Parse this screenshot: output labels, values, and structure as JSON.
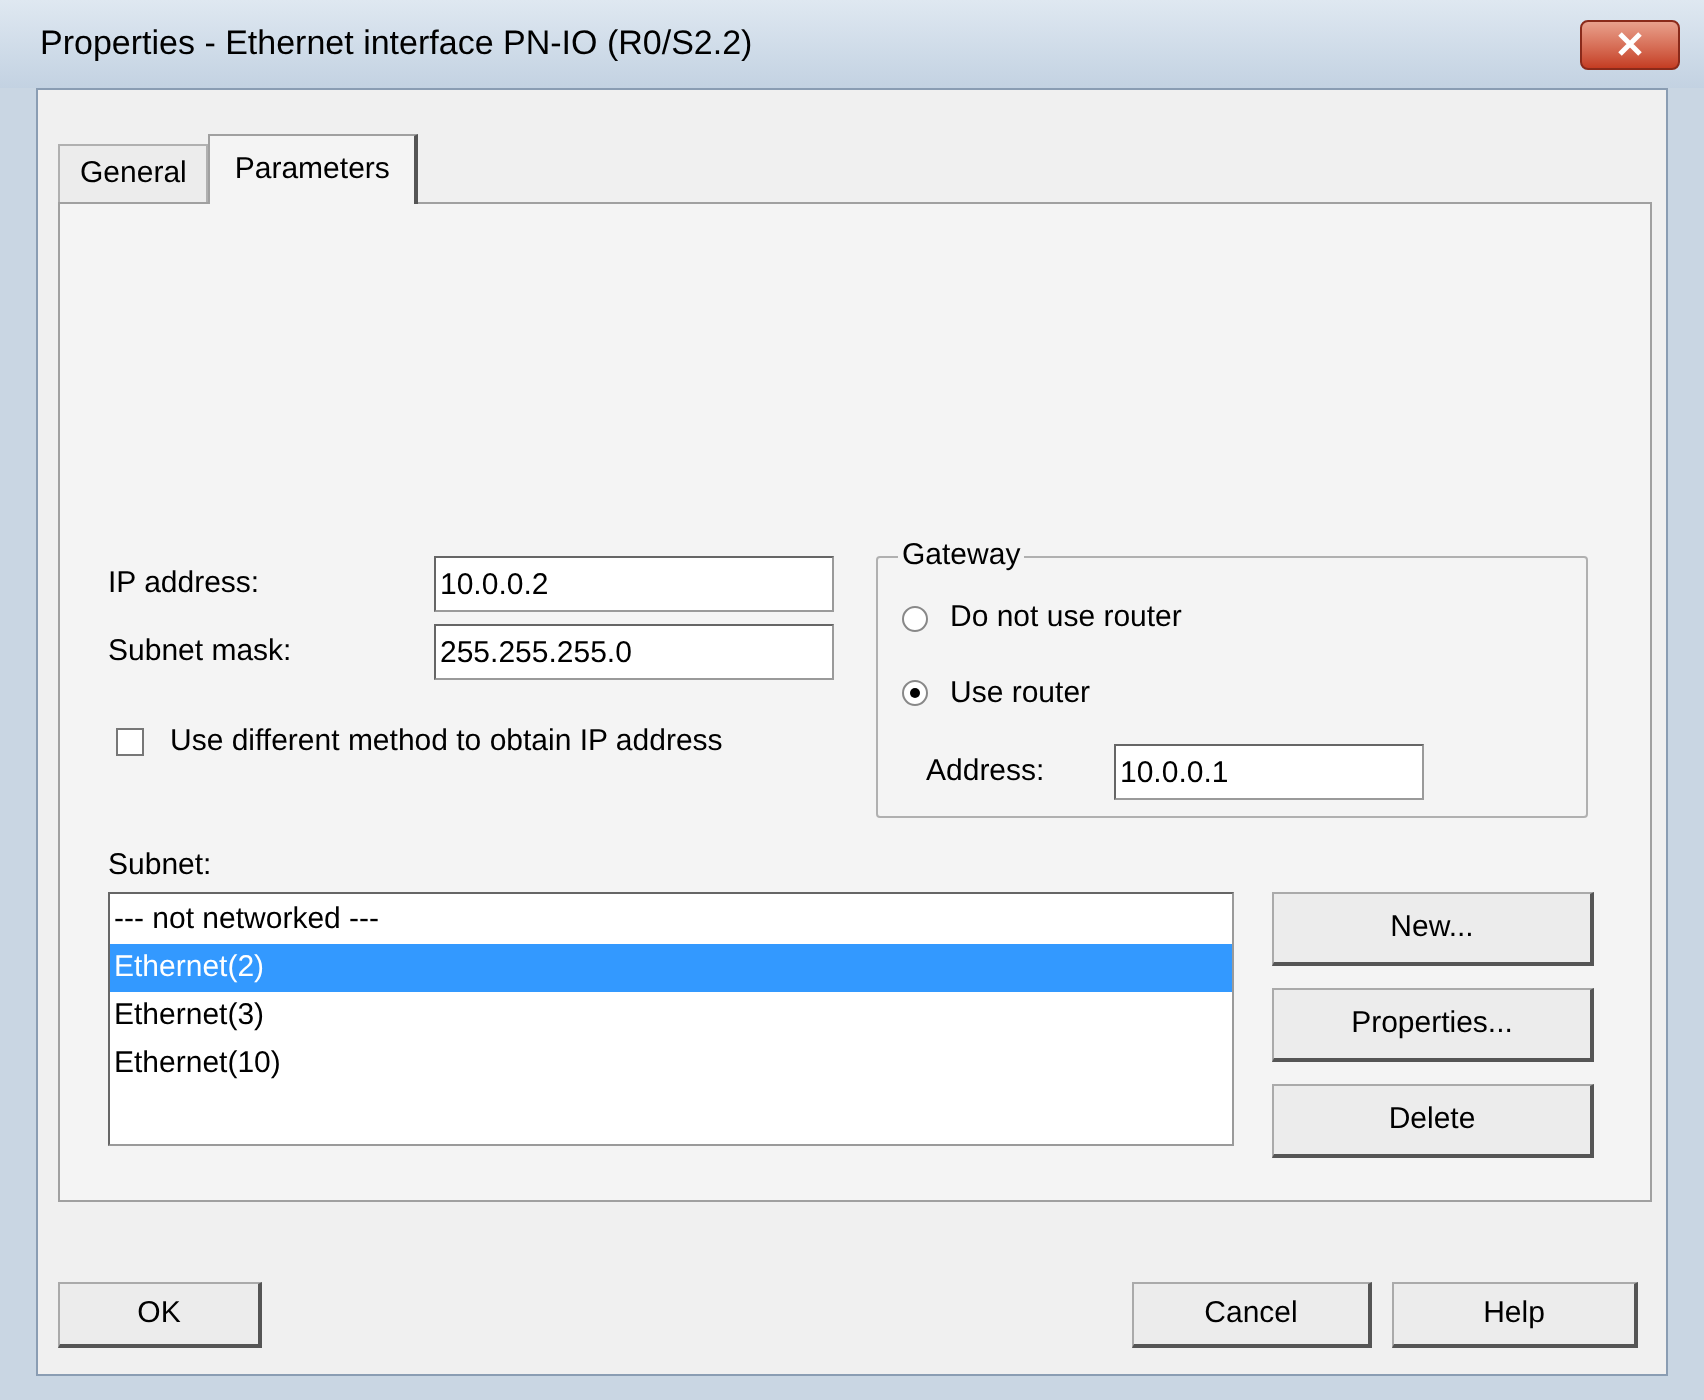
{
  "window": {
    "title": "Properties - Ethernet interface  PN-IO (R0/S2.2)"
  },
  "tabs": [
    {
      "label": "General",
      "selected": false
    },
    {
      "label": "Parameters",
      "selected": true
    }
  ],
  "ip_address": {
    "label": "IP address:",
    "value": "10.0.0.2"
  },
  "subnet_mask": {
    "label": "Subnet mask:",
    "value": "255.255.255.0"
  },
  "use_different_method": {
    "label": "Use different method to obtain IP address",
    "checked": false
  },
  "gateway": {
    "title": "Gateway",
    "options": [
      {
        "label": "Do not use router",
        "selected": false
      },
      {
        "label": "Use router",
        "selected": true
      }
    ],
    "address": {
      "label": "Address:",
      "value": "10.0.0.1"
    }
  },
  "subnet": {
    "label": "Subnet:",
    "items": [
      {
        "label": "--- not networked ---",
        "selected": false
      },
      {
        "label": "Ethernet(2)",
        "selected": true
      },
      {
        "label": "Ethernet(3)",
        "selected": false
      },
      {
        "label": "Ethernet(10)",
        "selected": false
      }
    ]
  },
  "subnet_buttons": [
    "New...",
    "Properties...",
    "Delete"
  ],
  "buttons": [
    "OK",
    "Cancel",
    "Help"
  ]
}
